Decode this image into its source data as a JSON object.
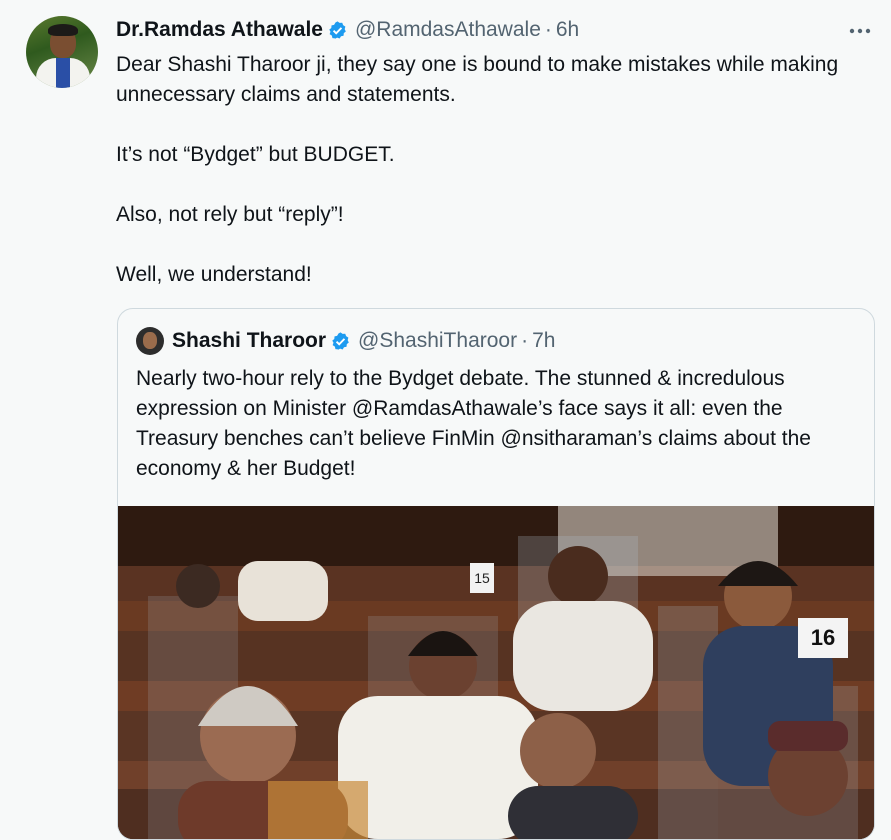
{
  "tweet": {
    "author_name": "Dr.Ramdas Athawale",
    "handle": "@RamdasAthawale",
    "separator": "·",
    "time": "6h",
    "more_icon": "more-horizontal-icon",
    "paragraphs": [
      "Dear Shashi Tharoor ji, they say one is bound to make mistakes while making unnecessary claims and statements.",
      "It’s not “Bydget” but BUDGET.",
      "Also, not rely but “reply”!",
      "Well, we understand!"
    ]
  },
  "quoted_tweet": {
    "author_name": "Shashi Tharoor",
    "handle": "@ShashiTharoor",
    "separator": "·",
    "time": "7h",
    "text": "Nearly two-hour rely to the Bydget debate. The stunned & incredulous expression on Minister @RamdasAthawale’s face says it all: even the Treasury benches can’t believe FinMin @nsitharaman’s claims about the economy & her Budget!",
    "photo_labels": [
      "15",
      "16"
    ]
  },
  "colors": {
    "verified": "#1d9bf0",
    "secondary_text": "#536471",
    "background": "#f7f9f9",
    "border": "#cfd9de"
  }
}
